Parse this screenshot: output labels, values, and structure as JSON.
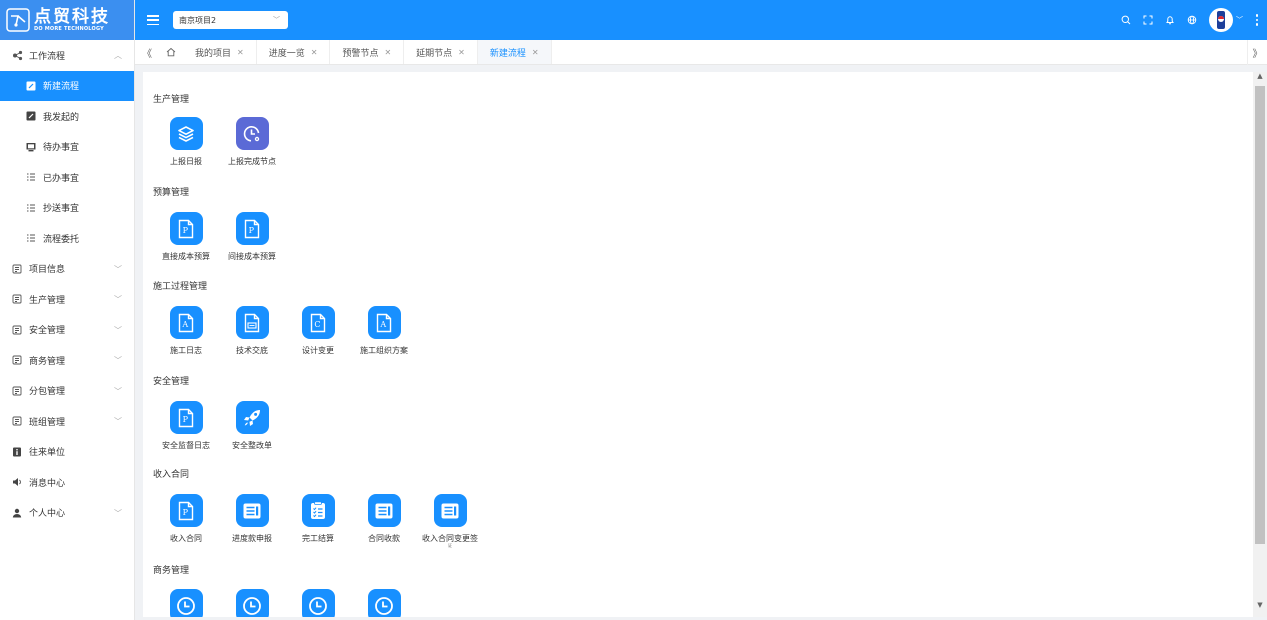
{
  "brand": {
    "name_cn": "点贸科技",
    "name_en": "DO MORE TECHNOLOGY"
  },
  "header": {
    "project": "南京项目2"
  },
  "sidebar": {
    "items": [
      {
        "label": "工作流程",
        "icon": "workflow-icon",
        "expandable": true,
        "expanded": true,
        "sub": false
      },
      {
        "label": "新建流程",
        "icon": "edit-icon",
        "sub": true,
        "active": true
      },
      {
        "label": "我发起的",
        "icon": "edit-icon",
        "sub": true
      },
      {
        "label": "待办事宜",
        "icon": "monitor-icon",
        "sub": true
      },
      {
        "label": "已办事宜",
        "icon": "list-icon",
        "sub": true
      },
      {
        "label": "抄送事宜",
        "icon": "list-icon",
        "sub": true
      },
      {
        "label": "流程委托",
        "icon": "list-icon",
        "sub": true
      },
      {
        "label": "项目信息",
        "icon": "form-icon",
        "expandable": true
      },
      {
        "label": "生产管理",
        "icon": "form-icon",
        "expandable": true
      },
      {
        "label": "安全管理",
        "icon": "form-icon",
        "expandable": true
      },
      {
        "label": "商务管理",
        "icon": "form-icon",
        "expandable": true
      },
      {
        "label": "分包管理",
        "icon": "form-icon",
        "expandable": true
      },
      {
        "label": "班组管理",
        "icon": "form-icon",
        "expandable": true
      },
      {
        "label": "往来单位",
        "icon": "info-icon"
      },
      {
        "label": "消息中心",
        "icon": "sound-icon"
      },
      {
        "label": "个人中心",
        "icon": "user-icon",
        "expandable": true
      }
    ]
  },
  "tabs": [
    {
      "label": "我的项目"
    },
    {
      "label": "进度一览"
    },
    {
      "label": "预警节点"
    },
    {
      "label": "延期节点"
    },
    {
      "label": "新建流程",
      "active": true
    }
  ],
  "sections": [
    {
      "title": "生产管理",
      "apps": [
        {
          "label": "上报日报",
          "icon": "layers-icon"
        },
        {
          "label": "上报完成节点",
          "icon": "clock-gear-icon",
          "color": "purple"
        }
      ]
    },
    {
      "title": "预算管理",
      "apps": [
        {
          "label": "直接成本预算",
          "icon": "doc-p-icon"
        },
        {
          "label": "间接成本预算",
          "icon": "doc-p-icon"
        }
      ]
    },
    {
      "title": "施工过程管理",
      "apps": [
        {
          "label": "施工日志",
          "icon": "doc-a-icon"
        },
        {
          "label": "技术交底",
          "icon": "doc-screen-icon"
        },
        {
          "label": "设计变更",
          "icon": "doc-c-icon"
        },
        {
          "label": "施工组织方案",
          "icon": "doc-a-icon"
        }
      ]
    },
    {
      "title": "安全管理",
      "apps": [
        {
          "label": "安全监督日志",
          "icon": "doc-p-icon"
        },
        {
          "label": "安全整改单",
          "icon": "rocket-icon"
        }
      ]
    },
    {
      "title": "收入合同",
      "apps": [
        {
          "label": "收入合同",
          "icon": "doc-p-icon"
        },
        {
          "label": "进度款申报",
          "icon": "list-card-icon"
        },
        {
          "label": "完工结算",
          "icon": "checklist-icon"
        },
        {
          "label": "合同收款",
          "icon": "list-card-icon"
        },
        {
          "label": "收入合同变更签",
          "sub": "证",
          "icon": "list-card-icon"
        }
      ]
    },
    {
      "title": "商务管理",
      "apps": [
        {
          "label": "",
          "icon": "clock-icon"
        },
        {
          "label": "",
          "icon": "clock-icon"
        },
        {
          "label": "",
          "icon": "clock-icon"
        },
        {
          "label": "",
          "icon": "clock-icon"
        }
      ]
    }
  ],
  "colors": {
    "primary": "#1890ff",
    "purple": "#5b6ad6",
    "header": "#1890ff",
    "logo_bg": "#3b8ff0"
  }
}
